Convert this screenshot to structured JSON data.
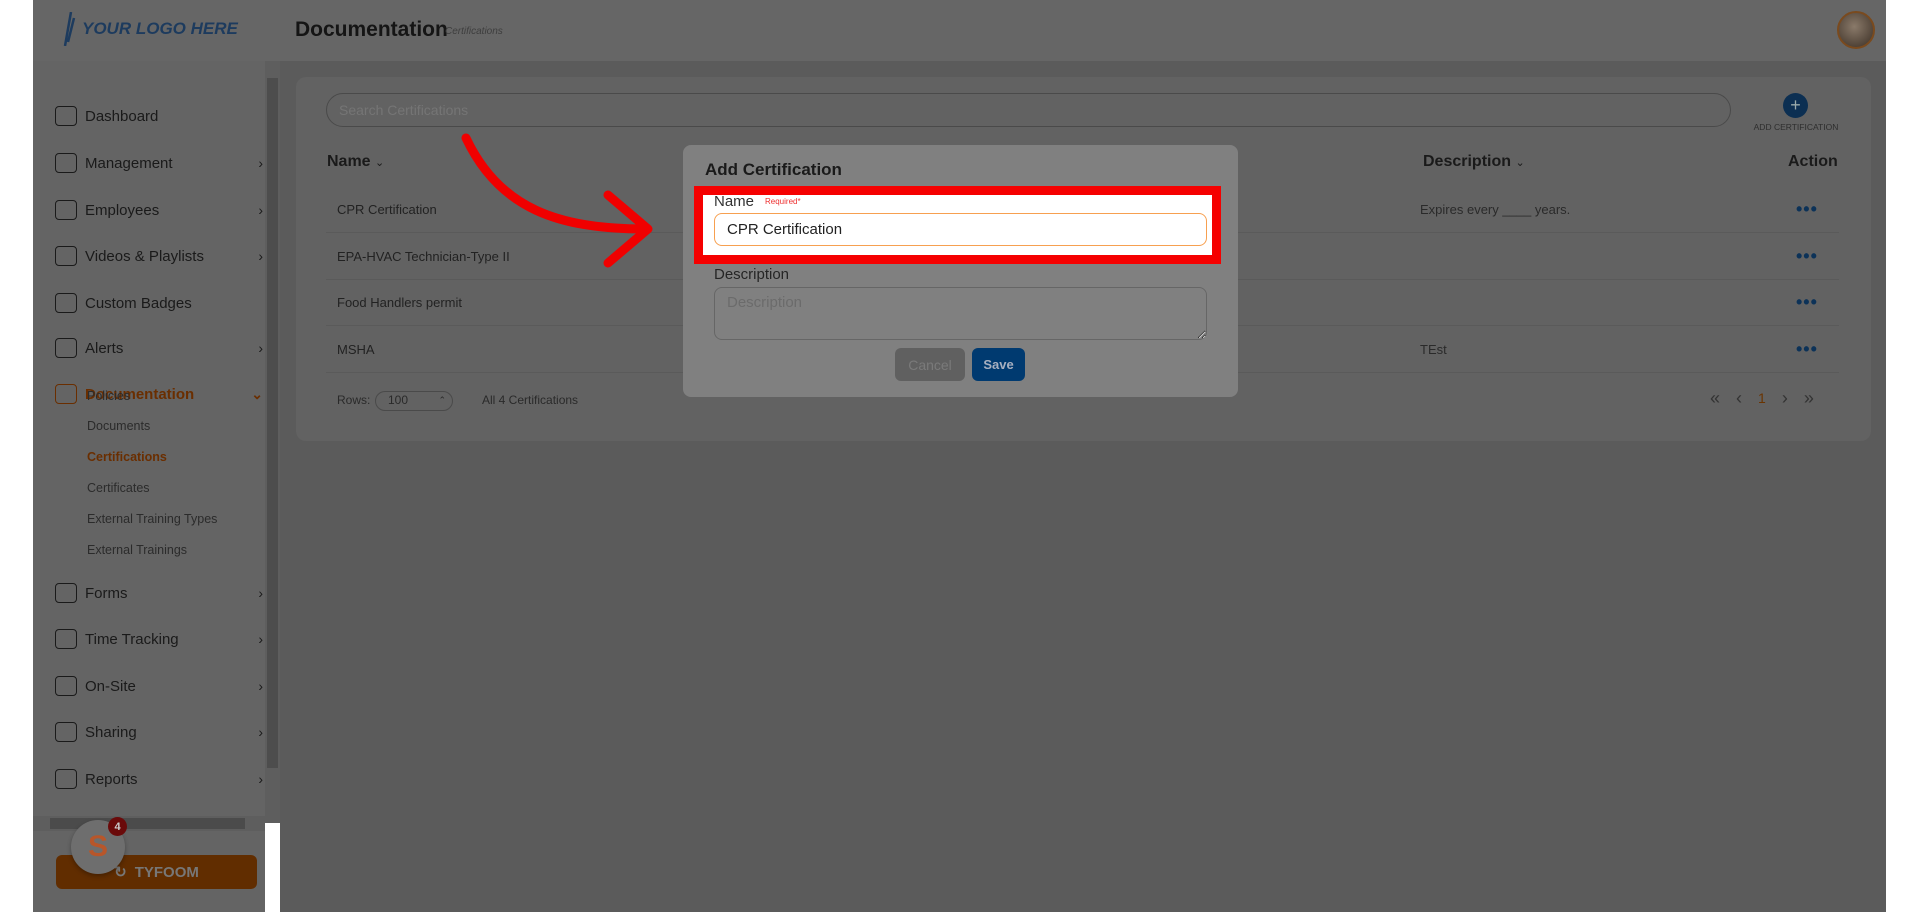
{
  "header": {
    "logo": "YOUR LOGO HERE",
    "title": "Documentation",
    "subtitle": "Certifications"
  },
  "sidebar": {
    "items": [
      {
        "label": "Dashboard",
        "icon": "dashboard-icon",
        "chevron": false
      },
      {
        "label": "Management",
        "icon": "people-icon",
        "chevron": true
      },
      {
        "label": "Employees",
        "icon": "person-icon",
        "chevron": true
      },
      {
        "label": "Videos & Playlists",
        "icon": "video-icon",
        "chevron": true
      },
      {
        "label": "Custom Badges",
        "icon": "badge-icon",
        "chevron": false
      },
      {
        "label": "Alerts",
        "icon": "alert-icon",
        "chevron": true
      },
      {
        "label": "Documentation",
        "icon": "document-icon",
        "chevron": true,
        "active": true
      }
    ],
    "subitems": [
      "Policies",
      "Documents",
      "Certifications",
      "Certificates",
      "External Training Types",
      "External Trainings"
    ],
    "active_subitem": "Certifications",
    "items2": [
      {
        "label": "Forms",
        "icon": "form-icon"
      },
      {
        "label": "Time Tracking",
        "icon": "stopwatch-icon"
      },
      {
        "label": "On-Site",
        "icon": "location-icon"
      },
      {
        "label": "Sharing",
        "icon": "sharing-icon"
      },
      {
        "label": "Reports",
        "icon": "reports-icon"
      }
    ],
    "tyfoom_label": "TYFOOM",
    "notification_count": "4"
  },
  "main": {
    "search_placeholder": "Search Certifications",
    "add_label": "ADD CERTIFICATION",
    "columns": {
      "name": "Name",
      "description": "Description",
      "action": "Action"
    },
    "rows": [
      {
        "name": "CPR Certification",
        "description": "Expires every ____ years."
      },
      {
        "name": "EPA-HVAC Technician-Type II",
        "description": ""
      },
      {
        "name": "Food Handlers permit",
        "description": ""
      },
      {
        "name": "MSHA",
        "description": "TEst"
      }
    ],
    "action_glyph": "•••",
    "rows_label": "Rows:",
    "rows_value": "100",
    "count_label": "All 4 Certifications",
    "current_page": "1"
  },
  "modal": {
    "title": "Add Certification",
    "name_label": "Name",
    "required": "Required*",
    "name_value": "CPR Certification",
    "description_label": "Description",
    "description_placeholder": "Description",
    "cancel": "Cancel",
    "save": "Save"
  },
  "colors": {
    "accent": "#e4640f",
    "primary": "#005aa8",
    "highlight": "#ff0000"
  }
}
